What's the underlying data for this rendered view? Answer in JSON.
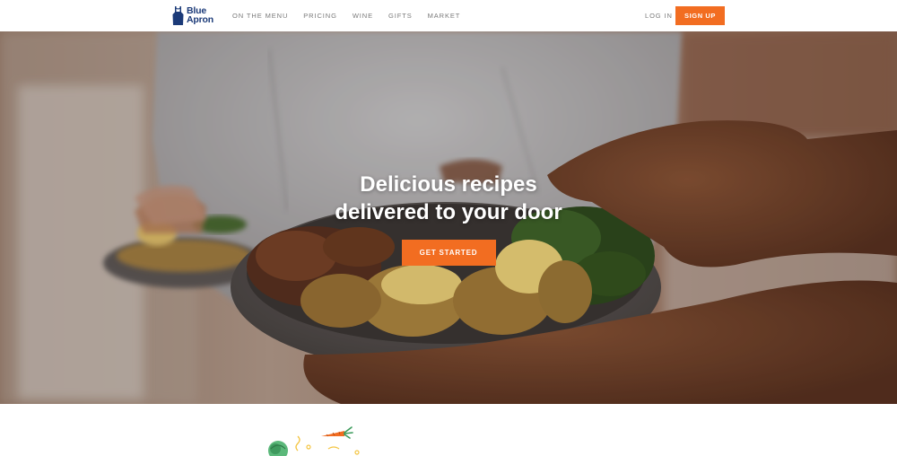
{
  "header": {
    "logo": {
      "line1": "Blue",
      "line2": "Apron",
      "icon": "apron-icon"
    },
    "nav": [
      {
        "label": "ON THE MENU"
      },
      {
        "label": "PRICING"
      },
      {
        "label": "WINE"
      },
      {
        "label": "GIFTS"
      },
      {
        "label": "MARKET"
      }
    ],
    "login_label": "LOG IN",
    "signup_label": "SIGN UP"
  },
  "hero": {
    "headline_line1": "Delicious recipes",
    "headline_line2": "delivered to your door",
    "cta_label": "GET STARTED",
    "image": "hands-holding-dinner-plates-photo"
  },
  "below_hero": {
    "icons": [
      "lettuce-icon",
      "carrot-icon",
      "confetti-icon"
    ]
  },
  "colors": {
    "brand_blue": "#1b3a78",
    "accent_orange": "#f26d21",
    "nav_text": "#7a7a7a"
  }
}
